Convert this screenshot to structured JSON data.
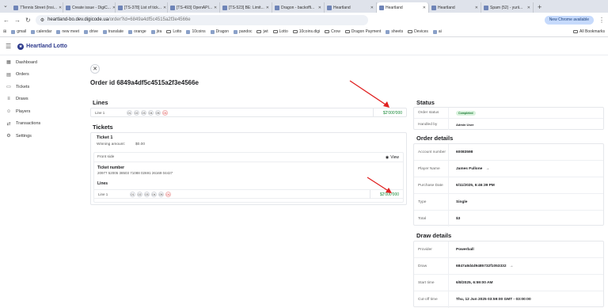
{
  "browser": {
    "tabs": [
      {
        "label": "7Tennis Street (Insi...",
        "active": false
      },
      {
        "label": "Create issue - DigiC...",
        "active": false
      },
      {
        "label": "[TS-378] List of tick...",
        "active": false
      },
      {
        "label": "[TS-493] OpenAPI...",
        "active": false
      },
      {
        "label": "[TS-523] BE: Limit...",
        "active": false
      },
      {
        "label": "Dragon - backoffi...",
        "active": false
      },
      {
        "label": "Heartland",
        "active": false
      },
      {
        "label": "Heartland",
        "active": true
      },
      {
        "label": "Heartland",
        "active": false
      },
      {
        "label": "Spam (52) - yurii...",
        "active": false
      }
    ],
    "url_host": "heartland-bo.dev.digicode.ua",
    "url_path": "/order?id=6849a4df5c4515a2f3e4566e",
    "new_version_label": "New Chrome available",
    "bookmarks": [
      "gmail",
      "calendar",
      "new meet",
      "drive",
      "translate",
      "orange",
      "jira",
      "Lotto",
      "10coins",
      "Dragon",
      "pandoc",
      "jwt",
      "Lotto",
      "10coins.digi",
      "Crow",
      "Dragon Payment",
      "sheets",
      "Devices",
      "ai"
    ],
    "all_bookmarks_label": "All Bookmarks"
  },
  "app": {
    "brand": "Heartland Lotto",
    "nav": [
      {
        "label": "Dashboard",
        "icon": "dashboard-icon"
      },
      {
        "label": "Orders",
        "icon": "orders-icon"
      },
      {
        "label": "Tickets",
        "icon": "tickets-icon"
      },
      {
        "label": "Draws",
        "icon": "draws-icon"
      },
      {
        "label": "Players",
        "icon": "players-icon"
      },
      {
        "label": "Transactions",
        "icon": "transactions-icon"
      },
      {
        "label": "Settings",
        "icon": "gear-icon"
      }
    ]
  },
  "order": {
    "title": "Order id 6849a4df5c4515a2f3e4566e",
    "lines_heading": "Lines",
    "line": {
      "label": "Line 1",
      "numbers": [
        "01",
        "02",
        "03",
        "04",
        "05"
      ],
      "bonus": "06",
      "amount": "$2'000'000"
    },
    "tickets_heading": "Tickets",
    "ticket": {
      "title": "Ticket 1",
      "winning_label": "Winning amount:",
      "winning_value": "$0.00",
      "front_side_label": "Front side",
      "view_label": "View",
      "number_label": "Ticket number",
      "number_value": "20977 52005 38503 71088 02691 26169 04427",
      "lines_label": "Lines",
      "line": {
        "label": "Line 1",
        "numbers": [
          "01",
          "02",
          "03",
          "04",
          "05"
        ],
        "bonus": "06",
        "amount": "$2'000'000"
      }
    },
    "status": {
      "heading": "Status",
      "order_status_label": "Order status",
      "order_status_value": "Completed",
      "handled_by_label": "Handled by",
      "handled_by_value": "Admin User"
    },
    "details": {
      "heading": "Order details",
      "rows": [
        {
          "label": "Account number",
          "value": "60083598"
        },
        {
          "label": "Player Name",
          "value": "James Fullone"
        },
        {
          "label": "Purchase Date",
          "value": "6/11/2025, 6:46:39 PM"
        },
        {
          "label": "Type",
          "value": "Single"
        },
        {
          "label": "Total",
          "value": "$3"
        }
      ]
    },
    "draw": {
      "heading": "Draw details",
      "rows": [
        {
          "label": "Provider",
          "value": "Powerball"
        },
        {
          "label": "Draw",
          "value": "6847a8d4d9485732f1053332"
        },
        {
          "label": "Start time",
          "value": "6/8/2025, 6:59:00 AM"
        },
        {
          "label": "Cut-off time",
          "value": "Thu, 12 Jun 2025 03:59:00 GMT - 03:00:00"
        }
      ]
    }
  },
  "colors": {
    "accent": "#2d3a8c",
    "amount": "#1a8a3a",
    "annotation": "#e02020"
  }
}
